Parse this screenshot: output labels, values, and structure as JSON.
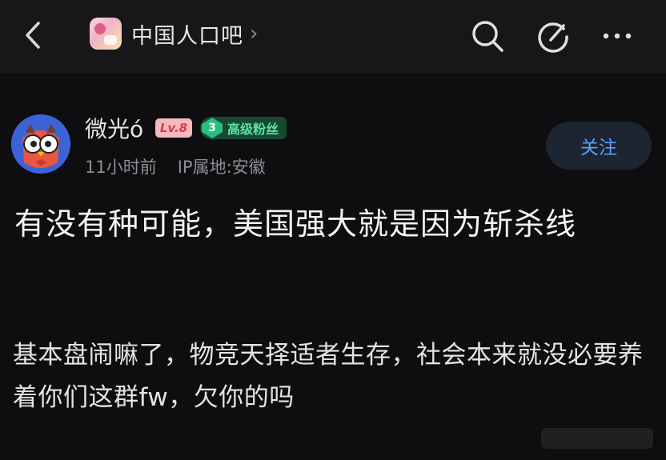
{
  "header": {
    "back_icon": "chevron-left-icon",
    "forum_name": "中国人口吧",
    "forum_chevron": "›",
    "icons": [
      "search-icon",
      "edit-icon",
      "more-icon"
    ]
  },
  "author": {
    "name": "微光ó",
    "level": "Lv.8",
    "fan_level": "3",
    "fan_title": "高级粉丝",
    "time": "11小时前",
    "ip": "IP属地:安徽",
    "follow_label": "关注"
  },
  "post": {
    "title": "有没有种可能，美国强大就是因为斩杀线",
    "body": "基本盘闹嘛了，物竞天择适者生存，社会本来就没必要养着你们这群fw，欠你的吗"
  },
  "colors": {
    "background": "#0e0e10",
    "topbar": "#17171a",
    "accent_blue": "#5aa0ff",
    "level_badge": "#f6b8bd",
    "fan_badge": "#164a33"
  }
}
